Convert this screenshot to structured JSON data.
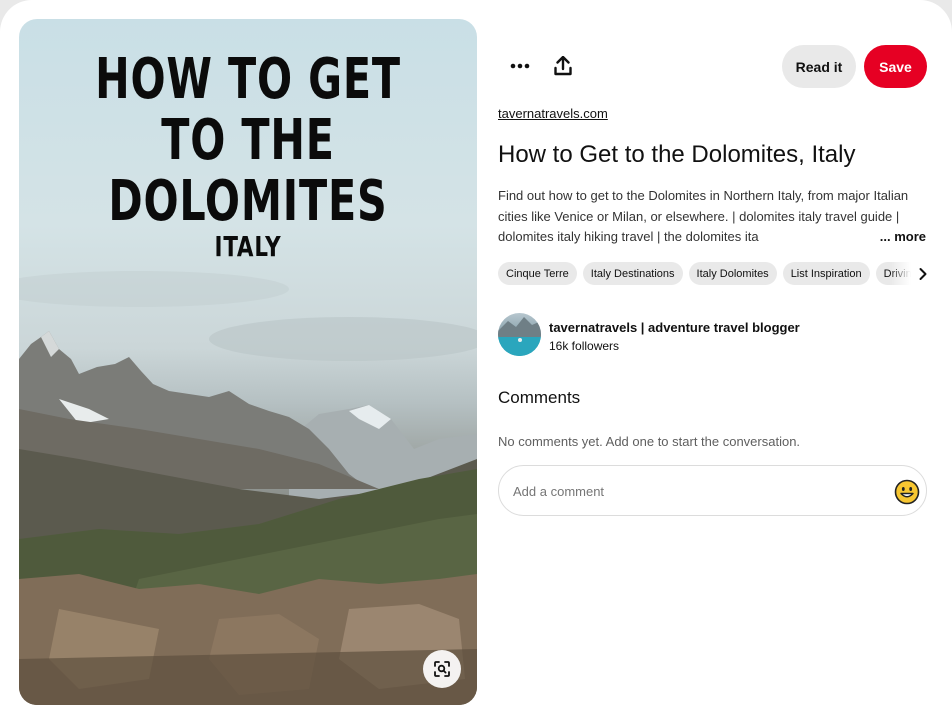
{
  "pin": {
    "image_title_lines": [
      "HOW TO GET",
      "TO THE",
      "DOLOMITES"
    ],
    "image_subtitle": "ITALY",
    "lens_icon": "visual-search-icon"
  },
  "actions": {
    "more_icon": "ellipsis-icon",
    "share_icon": "share-upload-icon",
    "read_label": "Read it",
    "save_label": "Save",
    "save_color": "#e60023"
  },
  "details": {
    "source": "tavernatravels.com",
    "title": "How to Get to the Dolomites, Italy",
    "description": "Find out how to get to the Dolomites in Northern Italy, from major Italian cities like Venice or Milan, or elsewhere. | dolomites italy travel guide | dolomites italy hiking travel | the dolomites ita",
    "more_label": "... more",
    "tags": [
      "Cinque Terre",
      "Italy Destinations",
      "Italy Dolomites",
      "List Inspiration",
      "Driving I"
    ]
  },
  "creator": {
    "name": "tavernatravels | adventure travel blogger",
    "followers": "16k followers"
  },
  "comments": {
    "heading": "Comments",
    "empty_text": "No comments yet. Add one to start the conversation.",
    "placeholder": "Add a comment"
  }
}
